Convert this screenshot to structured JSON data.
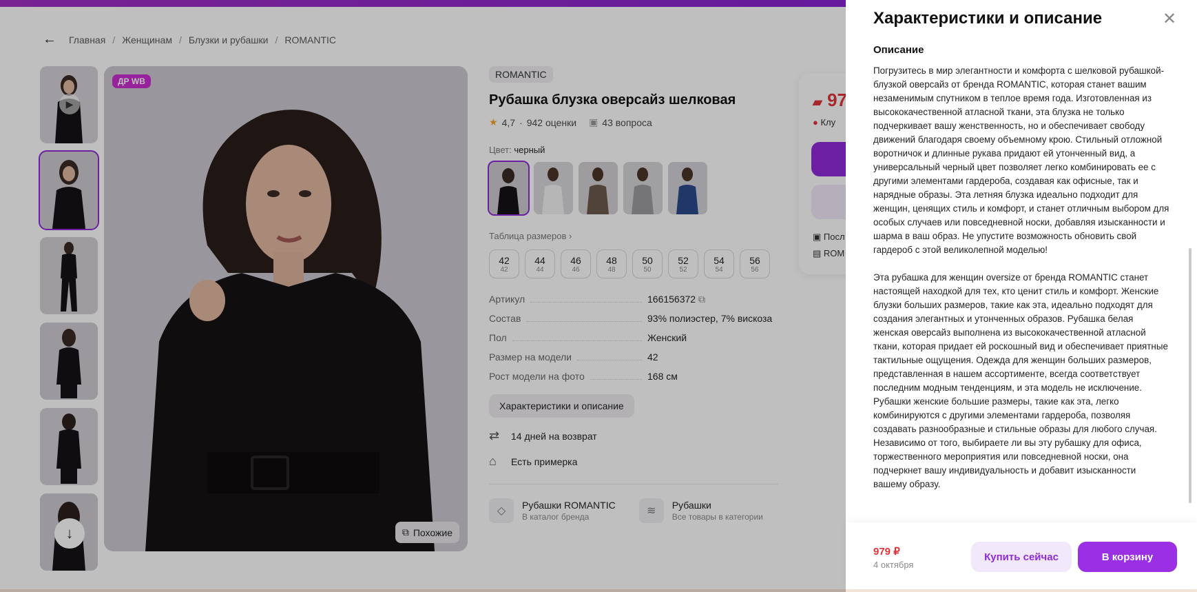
{
  "breadcrumbs": {
    "items": [
      "Главная",
      "Женщинам",
      "Блузки и рубашки",
      "ROMANTIC"
    ]
  },
  "gallery": {
    "badge": "ДР WB",
    "similar_label": "Похожие"
  },
  "product": {
    "brand": "ROMANTIC",
    "title": "Рубашка блузка оверсайз шелковая",
    "rating": "4,7",
    "reviews": "942 оценки",
    "questions": "43 вопроса",
    "color_label": "Цвет:",
    "color_value": "черный",
    "size_table_label": "Таблица размеров ›",
    "sizes": [
      {
        "size": "42",
        "ru": "42"
      },
      {
        "size": "44",
        "ru": "44"
      },
      {
        "size": "46",
        "ru": "46"
      },
      {
        "size": "48",
        "ru": "48"
      },
      {
        "size": "50",
        "ru": "50"
      },
      {
        "size": "52",
        "ru": "52"
      },
      {
        "size": "54",
        "ru": "54"
      },
      {
        "size": "56",
        "ru": "56"
      }
    ],
    "specs": [
      {
        "key": "Артикул",
        "value": "166156372"
      },
      {
        "key": "Состав",
        "value": "93% полиэстер, 7% вискоза"
      },
      {
        "key": "Пол",
        "value": "Женский"
      },
      {
        "key": "Размер на модели",
        "value": "42"
      },
      {
        "key": "Рост модели на фото",
        "value": "168 см"
      }
    ],
    "char_button": "Характеристики и описание",
    "features": [
      "14 дней на возврат",
      "Есть примерка"
    ],
    "links": [
      {
        "title": "Рубашки ROMANTIC",
        "subtitle": "В каталог бренда"
      },
      {
        "title": "Рубашки",
        "subtitle": "Все товары в категории"
      }
    ]
  },
  "pricebox": {
    "price_partial": "97",
    "chip_partial": "Клу",
    "line1": "Посл",
    "line2": "ROM"
  },
  "drawer": {
    "title": "Характеристики и описание",
    "section": "Описание",
    "paragraphs": [
      "Погрузитесь в мир элегантности и комфорта с шелковой рубашкой-блузкой оверсайз от бренда ROMANTIC, которая станет вашим незаменимым спутником в теплое время года. Изготовленная из высококачественной атласной ткани, эта блузка не только подчеркивает вашу женственность, но и обеспечивает свободу движений благодаря своему объемному крою. Стильный отложной воротничок и длинные рукава придают ей утонченный вид, а универсальный черный цвет позволяет легко комбинировать ее с другими элементами гардероба, создавая как офисные, так и нарядные образы. Эта летняя блузка идеально подходит для женщин, ценящих стиль и комфорт, и станет отличным выбором для особых случаев или повседневной носки, добавляя изысканности и шарма в ваш образ. Не упустите возможность обновить свой гардероб с этой великолепной моделью!",
      "Эта рубашка для женщин oversize от бренда ROMANTIC станет настоящей находкой для тех, кто ценит стиль и комфорт. Женские блузки больших размеров, такие как эта, идеально подходят для создания элегантных и утонченных образов. Рубашка белая женская оверсайз выполнена из высококачественной атласной ткани, которая придает ей роскошный вид и обеспечивает приятные тактильные ощущения. Одежда для женщин больших размеров, представленная в нашем ассортименте, всегда соответствует последним модным тенденциям, и эта модель не исключение. Рубашки женские большие размеры, такие как эта, легко комбинируются с другими элементами гардероба, позволяя создавать разнообразные и стильные образы для любого случая. Независимо от того, выбираете ли вы эту рубашку для офиса, торжественного мероприятия или повседневной носки, она подчеркнет вашу индивидуальность и добавит изысканности вашему образу."
    ],
    "footer": {
      "price": "979 ₽",
      "date": "4 октября",
      "buy_now": "Купить сейчас",
      "add_to_cart": "В корзину"
    }
  },
  "colors": {
    "accent": "#9a2fe3",
    "price": "#e0343a",
    "badge": "#cb2ecf"
  }
}
